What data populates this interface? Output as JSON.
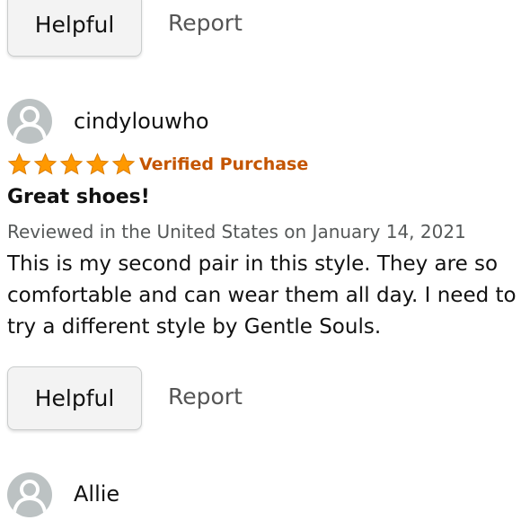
{
  "review_top_actions": {
    "helpful_label": "Helpful",
    "report_label": "Report"
  },
  "review": {
    "username": "cindylouwho",
    "rating_stars": 5,
    "max_stars": 5,
    "badge": "Verified Purchase",
    "title": "Great shoes!",
    "date_line": "Reviewed in the United States on January 14, 2021",
    "body": "This is my second pair in this style. They are so comfortable and can wear them all day. I need to try a different style by Gentle Souls.",
    "helpful_label": "Helpful",
    "report_label": "Report"
  },
  "next_review": {
    "username": "Allie"
  },
  "colors": {
    "star": "#ff9900",
    "badge": "#c45500",
    "avatar_bg": "#bcc2c3"
  },
  "icons": {
    "avatar": "person-icon",
    "star": "star-icon"
  }
}
